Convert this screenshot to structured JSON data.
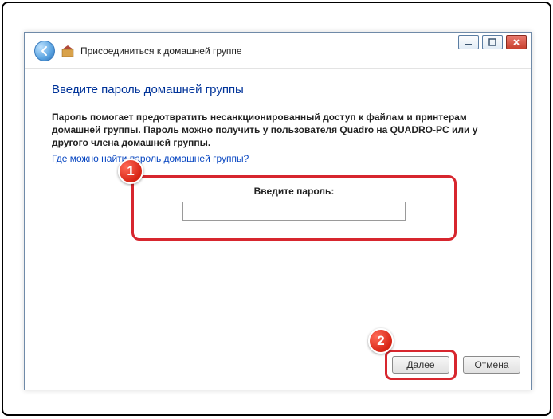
{
  "header": {
    "title": "Присоединиться к домашней группе"
  },
  "content": {
    "page_title": "Введите пароль домашней группы",
    "description": "Пароль помогает предотвратить несанкционированный доступ к файлам и принтерам домашней группы. Пароль можно получить у пользователя Quadro на QUADRO-PC или у другого члена домашней группы.",
    "link_text": "Где можно найти пароль домашней группы?",
    "password_label": "Введите пароль:",
    "password_value": ""
  },
  "footer": {
    "next_label": "Далее",
    "cancel_label": "Отмена"
  },
  "badges": {
    "one": "1",
    "two": "2"
  }
}
